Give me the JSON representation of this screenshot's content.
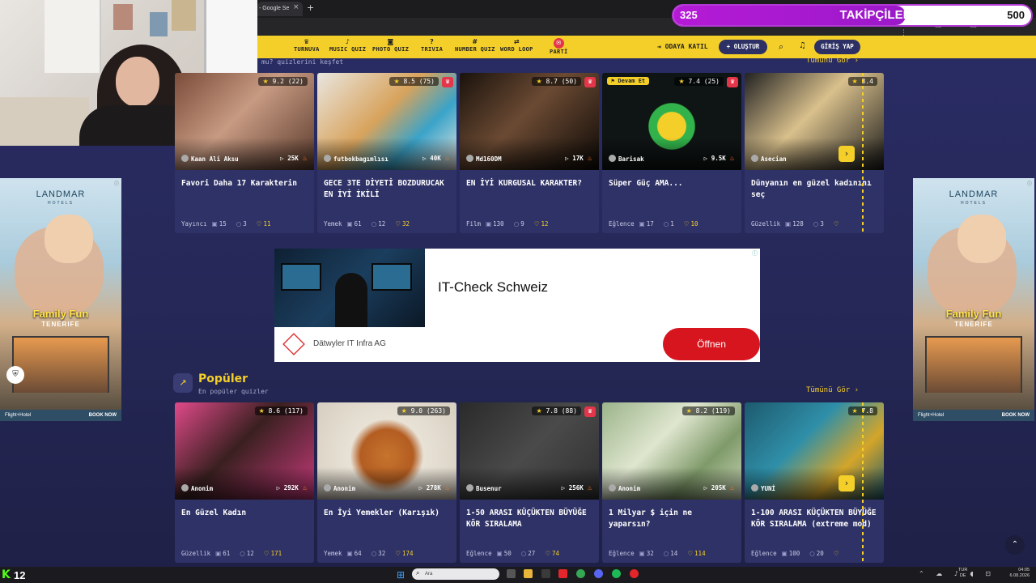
{
  "browser": {
    "tab_title": "- Google Se",
    "tab_close": "×",
    "new_tab": "+",
    "toolbar_icons": "★ ▤ ⬒ ⇩ ⋮"
  },
  "overlay": {
    "followers_current": "325",
    "followers_title": "TAKİPÇİLER",
    "followers_goal": "500",
    "followers_progress": 0.65
  },
  "nav": {
    "items": [
      {
        "icon": "♛",
        "label": "TURNUVA"
      },
      {
        "icon": "♪",
        "label": "MUSIC QUIZ"
      },
      {
        "icon": "◙",
        "label": "PHOTO QUIZ"
      },
      {
        "icon": "?",
        "label": "TRIVIA"
      },
      {
        "icon": "#",
        "label": "NUMBER QUIZ"
      },
      {
        "icon": "⇄",
        "label": "WORD LOOP"
      },
      {
        "icon": "✉",
        "label": "PARTİ"
      }
    ],
    "join_label": "⇥ ODAYA KATIL",
    "create_label": "+ OLUŞTUR",
    "search_icon": "⌕",
    "bell_icon": "♫",
    "login_label": "GİRİŞ YAP"
  },
  "discover": {
    "subtitle": "mu? quizlerini keşfet",
    "see_all": "Tümünü Gör ›"
  },
  "row1": [
    {
      "rating": "9.2",
      "count": "(22)",
      "author": "Kaan Ali Aksu",
      "plays": "25K",
      "title": "Favori Daha 17 Karakterin",
      "category": "Yayıncı",
      "questions": "15",
      "comments": "3",
      "likes": "11",
      "img": "linear-gradient(135deg,#7a4c3a,#c79a82 45%,#5a3a2c)"
    },
    {
      "rating": "8.5",
      "count": "(75)",
      "author": "futbokbagımlısı",
      "plays": "40K",
      "title": "GECE 3TE DİYETİ BOZDURUCAK EN İYİ İKİLİ",
      "category": "Yemek",
      "questions": "61",
      "comments": "12",
      "likes": "32",
      "img": "linear-gradient(135deg,#e9e6e0,#d8a35c 45%,#3aa3c9 70%,#e9e6e0)",
      "crown": "♛"
    },
    {
      "rating": "8.7",
      "count": "(50)",
      "author": "Md160DM",
      "plays": "17K",
      "title": "EN İYİ KURGUSAL KARAKTER?",
      "category": "Film",
      "questions": "130",
      "comments": "9",
      "likes": "12",
      "img": "linear-gradient(135deg,#1a120c,#6b4a33 45%,#0d0906)",
      "crown": "♛"
    },
    {
      "rating": "7.4",
      "count": "(25)",
      "author": "Barisak",
      "plays": "9.5K",
      "title": "Süper Güç AMA...",
      "category": "Eğlence",
      "questions": "17",
      "comments": "1",
      "likes": "10",
      "img": "radial-gradient(circle at 50% 55%,#f4cf2a 0,#f4cf2a 16%,#32b24a 17%,#32b24a 26%,#0f1414 27%)",
      "crown": "♛",
      "continue": "⚑ Devam Et"
    },
    {
      "rating": "8.4",
      "count": "",
      "author": "Asecian",
      "plays": "",
      "title": "Dünyanın en güzel kadınını seç",
      "category": "Güzellik",
      "questions": "128",
      "comments": "3",
      "likes": "",
      "img": "linear-gradient(135deg,#222,#d9c08c 45%,#1a1a1a)"
    }
  ],
  "midad": {
    "title": "IT-Check Schweiz",
    "company": "Dätwyler IT Infra AG",
    "button": "Öffnen",
    "info": "ⓘ"
  },
  "sidead": {
    "brand": "LANDMAR",
    "brand_sub": "HOTELS",
    "headline": "Family Fun",
    "destination": "TENERIFE",
    "footer": "Flight+Hotel",
    "book": "BOOK NOW",
    "info": "ⓘ"
  },
  "popular": {
    "icon": "↗",
    "title": "Popüler",
    "subtitle": "En popüler quizler",
    "see_all": "Tümünü Gör ›"
  },
  "row2": [
    {
      "rating": "8.6",
      "count": "(117)",
      "author": "Anonim",
      "plays": "292K",
      "title": "En Güzel Kadın",
      "category": "Güzellik",
      "questions": "61",
      "comments": "12",
      "likes": "171",
      "img": "linear-gradient(135deg,#e04a8a,#3a2020 45%,#c53a7a)"
    },
    {
      "rating": "9.0",
      "count": "(263)",
      "author": "Anonim",
      "plays": "278K",
      "title": "En İyi Yemekler (Karışık)",
      "category": "Yemek",
      "questions": "64",
      "comments": "32",
      "likes": "174",
      "img": "radial-gradient(circle at 50% 55%,#c7742e 0,#b35d22 30%,#e8e2d6 42%,#d6cec0 100%)"
    },
    {
      "rating": "7.8",
      "count": "(88)",
      "author": "Busenur",
      "plays": "256K",
      "title": "1-50 ARASI KÜÇÜKTEN BÜYÜĞE KÖR SIRALAMA",
      "category": "Eğlence",
      "questions": "50",
      "comments": "27",
      "likes": "74",
      "img": "linear-gradient(135deg,#2a2a2a,#4a4a4a 50%,#2f2f2f)",
      "crown": "♛"
    },
    {
      "rating": "8.2",
      "count": "(119)",
      "author": "Anonim",
      "plays": "205K",
      "title": "1 Milyar $ için ne yaparsın?",
      "category": "Eğlence",
      "questions": "32",
      "comments": "14",
      "likes": "114",
      "img": "linear-gradient(135deg,#9bb48a,#dfe6cf 40%,#7f9a6a 70%,#c9d6b6)"
    },
    {
      "rating": "7.8",
      "count": "",
      "author": "YUNİ",
      "plays": "",
      "title": "1-100 ARASI KÜÇÜKTEN BÜYÜĞE KÖR SIRALAMA (extreme mod)",
      "category": "Eğlence",
      "questions": "100",
      "comments": "20",
      "likes": "",
      "img": "linear-gradient(135deg,#1d5a6e,#2f8fa8 40%,#d4a52a 70%,#1d5a6e)"
    }
  ],
  "icons": {
    "questions": "▣",
    "comments": "○",
    "likes": "♡",
    "star": "★",
    "flame": "♨",
    "next": "›",
    "scroll_top": "⌃",
    "shield": "⛨"
  },
  "taskbar": {
    "kick_logo": "K",
    "kick_count": "12",
    "start": "⊞",
    "search_placeholder": "Ara",
    "search_icon": "⌕",
    "tray_icons": "⌃ ☁ ♪ ◖ ⊡",
    "lang": "TUR",
    "region": "DE",
    "time": "04:05",
    "date": "6.08.2026"
  }
}
